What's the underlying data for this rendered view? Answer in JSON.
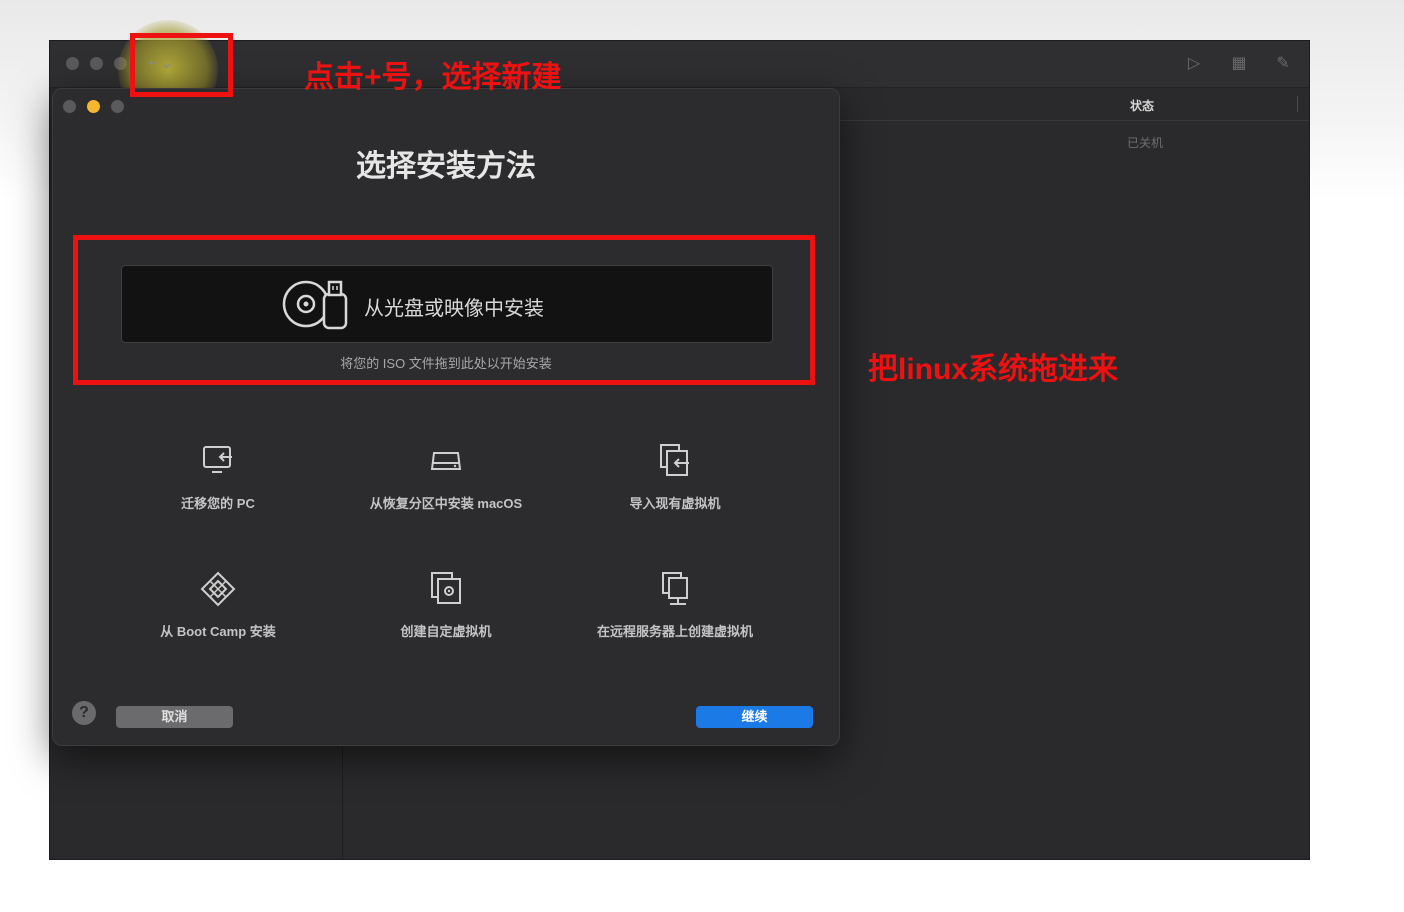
{
  "main_window": {
    "add_button": "+ ⌄",
    "status_column": "状态",
    "status_value": "已关机"
  },
  "dialog": {
    "title": "选择安装方法",
    "drop_zone": {
      "label": "从光盘或映像中安装",
      "hint": "将您的 ISO 文件拖到此处以开始安装"
    },
    "options": [
      {
        "label": "迁移您的 PC",
        "icon": "migrate-pc-icon"
      },
      {
        "label": "从恢复分区中安装 macOS",
        "icon": "drive-icon"
      },
      {
        "label": "导入现有虚拟机",
        "icon": "import-vm-icon"
      },
      {
        "label": "从 Boot Camp 安装",
        "icon": "bootcamp-icon"
      },
      {
        "label": "创建自定虚拟机",
        "icon": "custom-vm-icon"
      },
      {
        "label": "在远程服务器上创建虚拟机",
        "icon": "remote-server-icon"
      }
    ],
    "help": "?",
    "cancel": "取消",
    "continue": "继续"
  },
  "annotations": {
    "top": "点击+号，选择新建",
    "right": "把linux系统拖进来",
    "color": "#ee1111"
  },
  "colors": {
    "accent": "#1b7ae6",
    "traffic_yellow": "#f5b731"
  }
}
